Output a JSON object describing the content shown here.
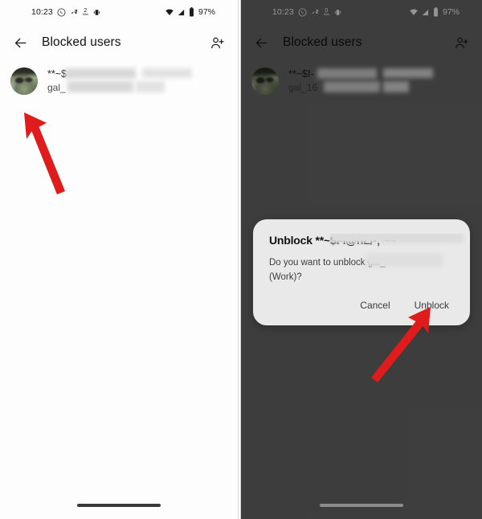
{
  "panels": [
    {
      "id": "left",
      "theme": "light",
      "status_bar": {
        "time": "10:23",
        "icons": [
          "whatsapp-icon",
          "missed-call-icon",
          "data-speed-icon",
          "vibrate-icon"
        ],
        "data_speed_value": "2",
        "data_speed_unit": "KB/s",
        "right_icons": [
          "wifi-icon",
          "signal-icon",
          "battery-icon"
        ],
        "battery_percent": "97%"
      },
      "app_bar": {
        "back_icon": "arrow-back-icon",
        "title": "Blocked users",
        "action_icon": "person-add-icon"
      },
      "list": [
        {
          "name": "**~$",
          "subtitle": "gal_",
          "avatar": "contact-avatar",
          "redacted": true
        }
      ],
      "gesture_bar": "home-indicator"
    },
    {
      "id": "right",
      "theme": "dim",
      "status_bar": {
        "time": "10:23",
        "icons": [
          "whatsapp-icon",
          "missed-call-icon",
          "data-speed-icon",
          "vibrate-icon"
        ],
        "data_speed_value": "0",
        "data_speed_unit": "KB/s",
        "right_icons": [
          "wifi-icon",
          "signal-icon",
          "battery-icon"
        ],
        "battery_percent": "97%"
      },
      "app_bar": {
        "back_icon": "arrow-back-icon",
        "title": "Blocked users",
        "action_icon": "person-add-icon"
      },
      "list": [
        {
          "name": "**~$I-",
          "subtitle": "gal_16",
          "avatar": "contact-avatar",
          "redacted": true
        }
      ],
      "dialog": {
        "title": "Unblock **~$I-I@nL/-; ~~",
        "body_line1": "Do you want to unblock gal_",
        "body_line2": "(Work)?",
        "cancel_label": "Cancel",
        "confirm_label": "Unblock"
      },
      "gesture_bar": "home-indicator"
    }
  ],
  "annotations": [
    {
      "name": "arrow-to-contact-row",
      "color": "#e01b1b",
      "direction": "up-left"
    },
    {
      "name": "arrow-to-unblock-button",
      "color": "#e01b1b",
      "direction": "up-right"
    }
  ]
}
